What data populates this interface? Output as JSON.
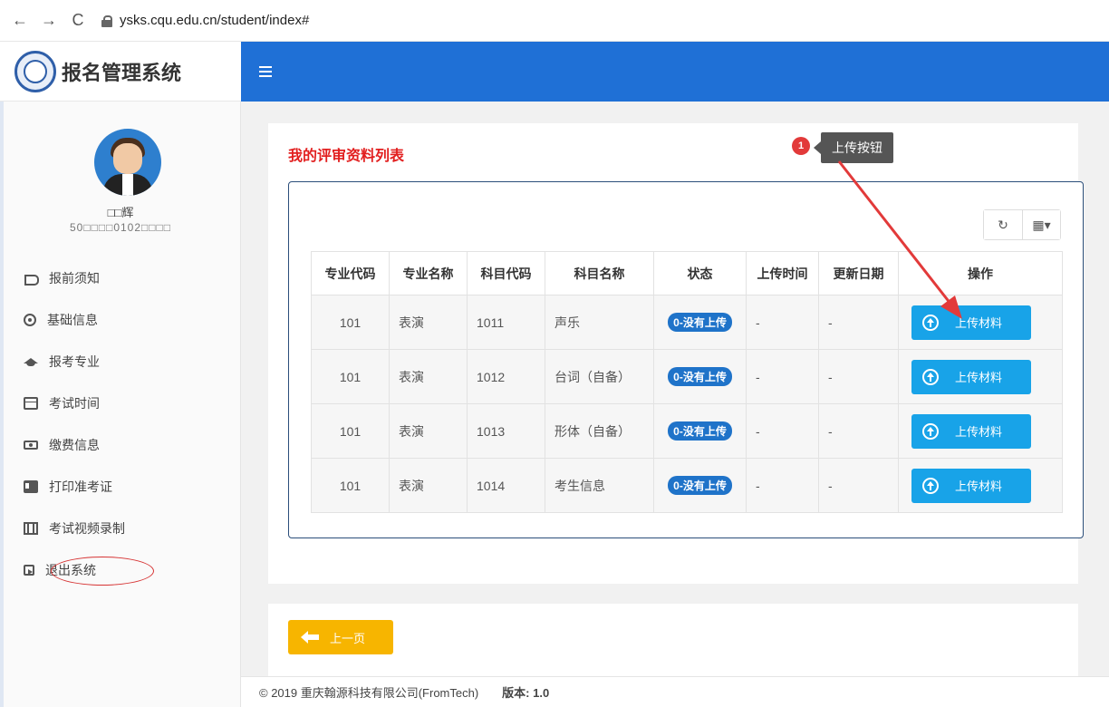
{
  "browser": {
    "back": "←",
    "forward": "→",
    "reload": "C",
    "url": "ysks.cqu.edu.cn/student/index#"
  },
  "sidebar": {
    "brand_title": "报名管理系统",
    "user_name": "□□辉",
    "user_id": "50□□□□0102□□□□",
    "items": [
      {
        "label": "报前须知",
        "icon": "bullhorn-icon"
      },
      {
        "label": "基础信息",
        "icon": "user-circle-icon"
      },
      {
        "label": "报考专业",
        "icon": "graduation-cap-icon"
      },
      {
        "label": "考试时间",
        "icon": "calendar-icon"
      },
      {
        "label": "缴费信息",
        "icon": "money-icon"
      },
      {
        "label": "打印准考证",
        "icon": "id-card-icon"
      },
      {
        "label": "考试视频录制",
        "icon": "film-icon"
      },
      {
        "label": "退出系统",
        "icon": "sign-out-icon"
      }
    ]
  },
  "main": {
    "panel_title": "我的评审资料列表",
    "toolbar": {
      "refresh": "↻",
      "columns": "▦▾"
    },
    "table": {
      "headers": [
        "专业代码",
        "专业名称",
        "科目代码",
        "科目名称",
        "状态",
        "上传时间",
        "更新日期",
        "操作"
      ],
      "rows": [
        {
          "major_code": "101",
          "major_name": "表演",
          "subject_code": "1011",
          "subject_name": "声乐",
          "status": "0-没有上传",
          "upload_time": "-",
          "update_date": "-",
          "action": "上传材料"
        },
        {
          "major_code": "101",
          "major_name": "表演",
          "subject_code": "1012",
          "subject_name": "台词（自备）",
          "status": "0-没有上传",
          "upload_time": "-",
          "update_date": "-",
          "action": "上传材料"
        },
        {
          "major_code": "101",
          "major_name": "表演",
          "subject_code": "1013",
          "subject_name": "形体（自备）",
          "status": "0-没有上传",
          "upload_time": "-",
          "update_date": "-",
          "action": "上传材料"
        },
        {
          "major_code": "101",
          "major_name": "表演",
          "subject_code": "1014",
          "subject_name": "考生信息",
          "status": "0-没有上传",
          "upload_time": "-",
          "update_date": "-",
          "action": "上传材料"
        }
      ]
    },
    "prev_button": "上一页"
  },
  "annotation": {
    "number": "1",
    "text": "上传按钮",
    "color": "#e23a3a"
  },
  "footer": {
    "copyright": "© 2019 重庆翰源科技有限公司(FromTech)",
    "version": "版本: 1.0"
  },
  "colors": {
    "header_blue": "#1f70d6",
    "upload_button": "#18a3e8",
    "status_badge": "#1f73c9",
    "prev_button": "#f7b500",
    "title_red": "#e21f1f"
  }
}
